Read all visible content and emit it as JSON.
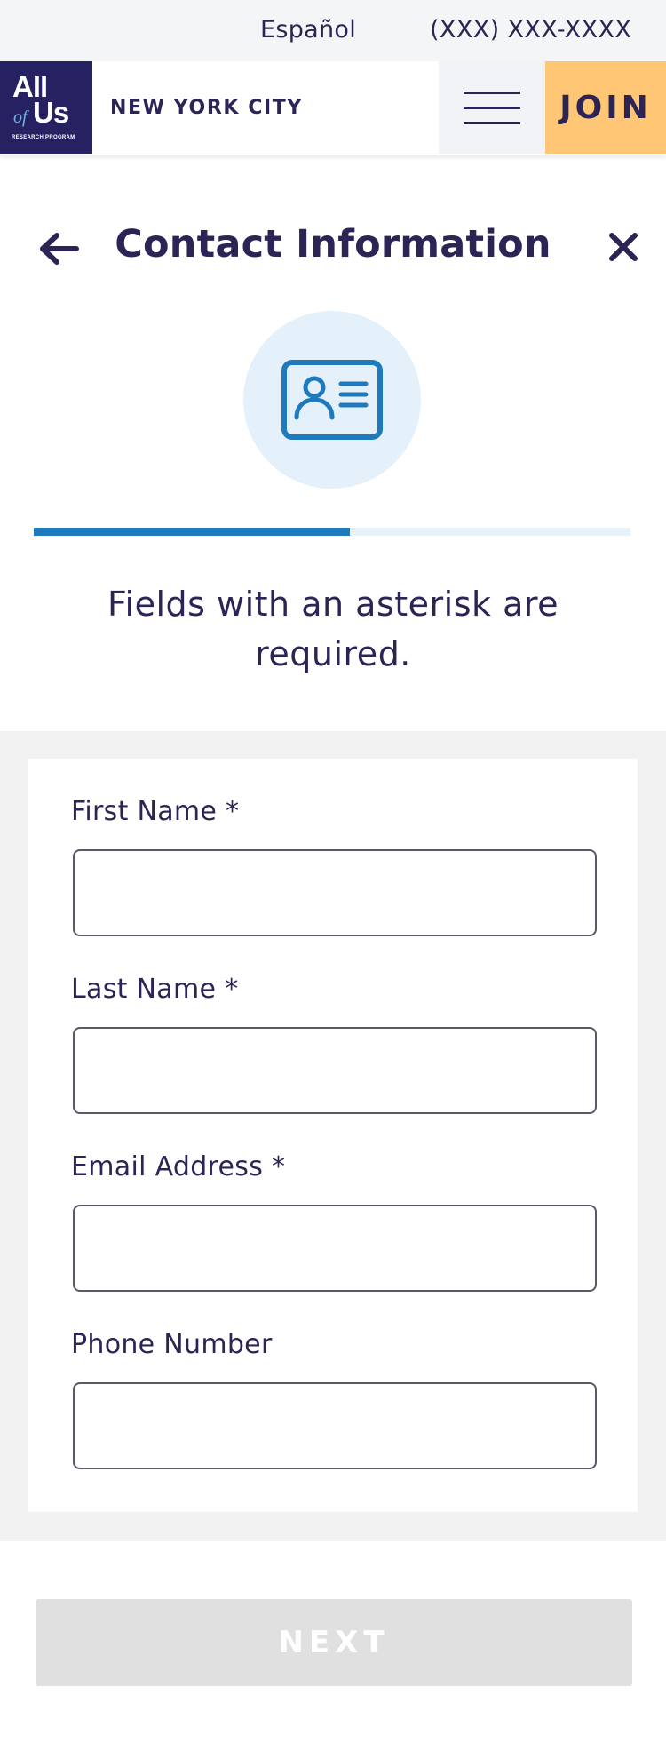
{
  "utility_bar": {
    "language_link": "Español",
    "phone": "(XXX) XXX-XXXX"
  },
  "header": {
    "logo": {
      "line1": "All",
      "line2_of": "of",
      "line2_us": "Us",
      "sub": "RESEARCH PROGRAM"
    },
    "city": "NEW YORK CITY",
    "menu_icon": "hamburger-menu-icon",
    "join_label": "JOIN"
  },
  "title_bar": {
    "back_icon": "arrow-left-icon",
    "title": "Contact Information",
    "close_icon": "close-x-icon"
  },
  "step_icon": "contact-card-icon",
  "progress": {
    "fraction": 0.53
  },
  "instructions": "Fields with an asterisk are required.",
  "form": {
    "fields": [
      {
        "label": "First Name *",
        "value": "",
        "placeholder": ""
      },
      {
        "label": "Last Name *",
        "value": "",
        "placeholder": ""
      },
      {
        "label": "Email Address *",
        "value": "",
        "placeholder": ""
      },
      {
        "label": "Phone Number",
        "value": "",
        "placeholder": ""
      }
    ]
  },
  "next_label": "NEXT",
  "colors": {
    "brand_navy": "#262262",
    "text": "#2b2454",
    "join_bg": "#ffc676",
    "accent_blue": "#1f79bd",
    "icon_circle_bg": "#e5f1fa",
    "disabled_button": "#e0e0e1"
  }
}
